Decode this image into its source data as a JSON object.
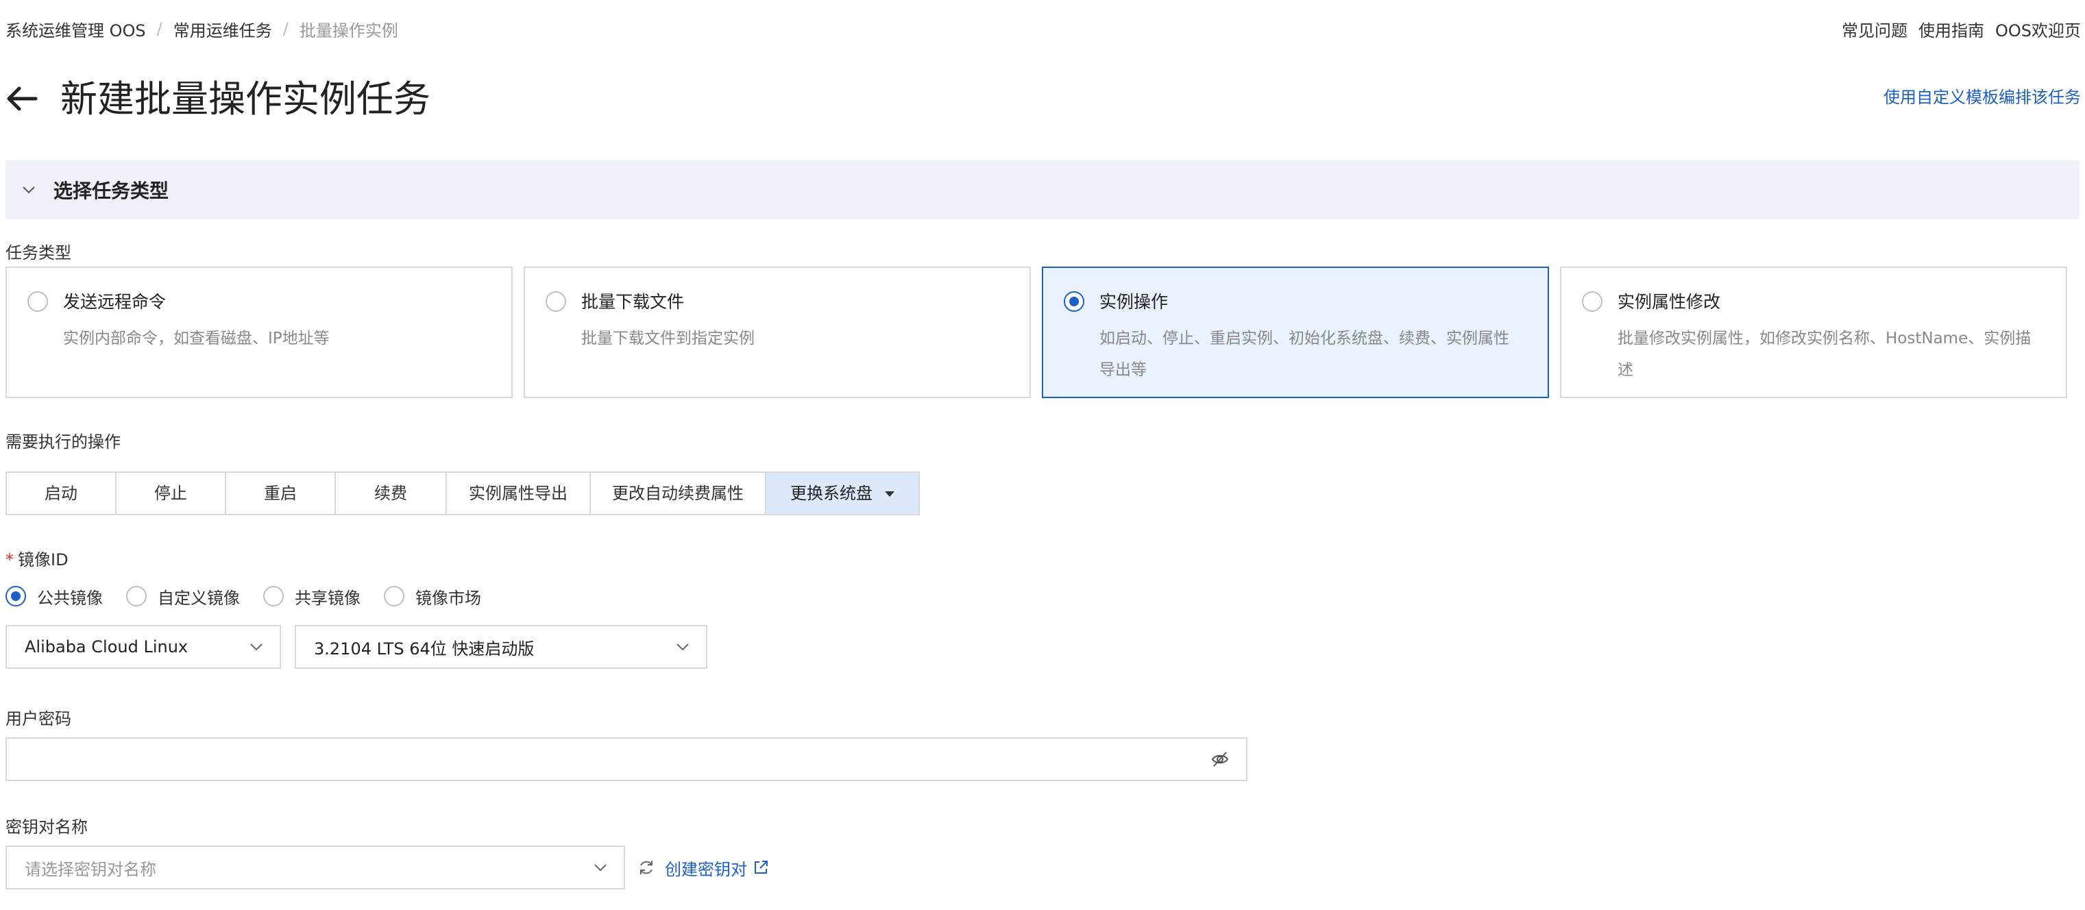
{
  "breadcrumb": {
    "items": [
      "系统运维管理 OOS",
      "常用运维任务",
      "批量操作实例"
    ],
    "separator": "/"
  },
  "top_links": [
    "常见问题",
    "使用指南",
    "OOS欢迎页"
  ],
  "page": {
    "title": "新建批量操作实例任务",
    "custom_template_link": "使用自定义模板编排该任务"
  },
  "section": {
    "title": "选择任务类型"
  },
  "task_type": {
    "label": "任务类型",
    "cards": [
      {
        "title": "发送远程命令",
        "desc": "实例内部命令，如查看磁盘、IP地址等",
        "selected": false
      },
      {
        "title": "批量下载文件",
        "desc": "批量下载文件到指定实例",
        "selected": false
      },
      {
        "title": "实例操作",
        "desc": "如启动、停止、重启实例、初始化系统盘、续费、实例属性导出等",
        "selected": true
      },
      {
        "title": "实例属性修改",
        "desc": "批量修改实例属性，如修改实例名称、HostName、实例描述",
        "selected": false
      }
    ]
  },
  "operations": {
    "label": "需要执行的操作",
    "items": [
      "启动",
      "停止",
      "重启",
      "续费",
      "实例属性导出",
      "更改自动续费属性",
      "更换系统盘"
    ],
    "active_index": 6
  },
  "image_id": {
    "label": "镜像ID",
    "required_mark": "*",
    "sources": [
      "公共镜像",
      "自定义镜像",
      "共享镜像",
      "镜像市场"
    ],
    "selected_source_index": 0,
    "os_select": "Alibaba Cloud Linux",
    "version_select": "3.2104 LTS 64位 快速启动版"
  },
  "password": {
    "label": "用户密码",
    "value": ""
  },
  "keypair": {
    "label": "密钥对名称",
    "placeholder": "请选择密钥对名称",
    "create_link": "创建密钥对"
  },
  "colors": {
    "accent": "#1c5fc7",
    "selected_bg": "#e8f1fc",
    "section_bg": "#eef2f8",
    "border": "#d9d9d9",
    "required": "#d93026"
  }
}
